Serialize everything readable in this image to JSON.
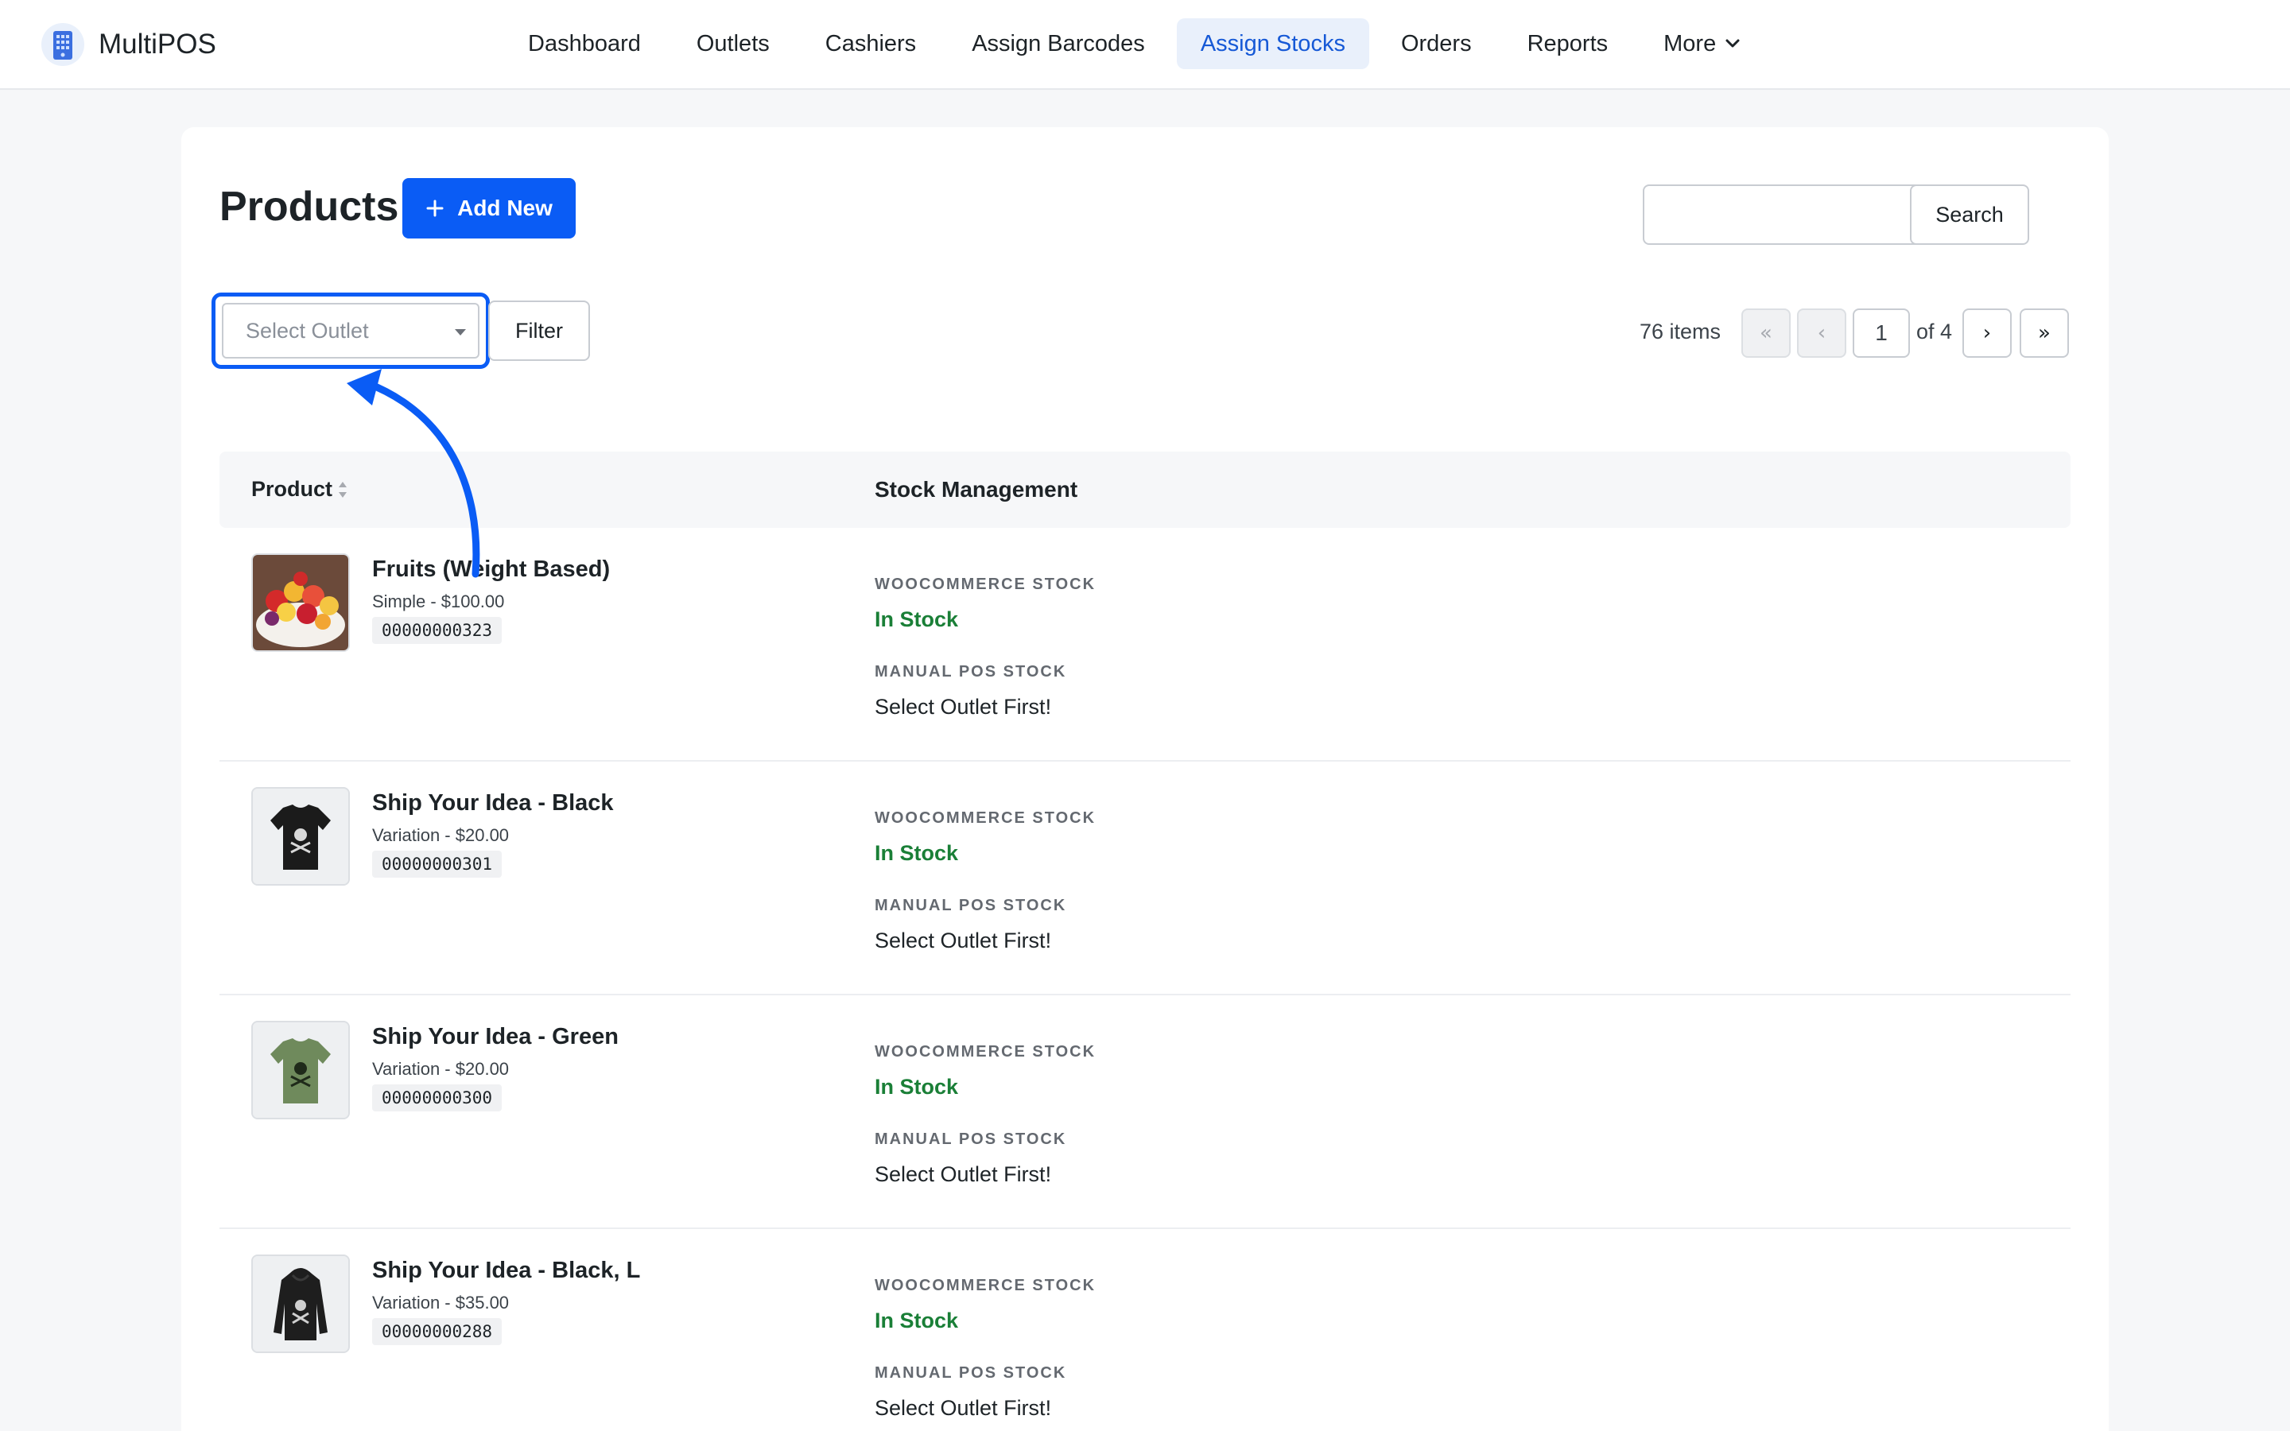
{
  "brand": {
    "name": "MultiPOS"
  },
  "nav": {
    "items": [
      {
        "label": "Dashboard"
      },
      {
        "label": "Outlets"
      },
      {
        "label": "Cashiers"
      },
      {
        "label": "Assign Barcodes"
      },
      {
        "label": "Assign Stocks",
        "active": true
      },
      {
        "label": "Orders"
      },
      {
        "label": "Reports"
      },
      {
        "label": "More"
      }
    ]
  },
  "page": {
    "title": "Products",
    "add_new_label": "Add New",
    "search": {
      "value": "",
      "button_label": "Search"
    },
    "outlet_select": {
      "placeholder": "Select Outlet"
    },
    "filter_label": "Filter"
  },
  "pagination": {
    "items_count": "76 items",
    "first": "«",
    "prev": "‹",
    "current_page": "1",
    "of_pages": "of 4",
    "next": "›",
    "last": "»"
  },
  "table": {
    "columns": {
      "product": "Product",
      "stock": "Stock Management"
    },
    "rows": [
      {
        "name": "Fruits (Weight Based)",
        "meta": "Simple - $100.00",
        "sku": "00000000323",
        "thumb": "fruit-bowl",
        "woo_label": "WOOCOMMERCE STOCK",
        "woo_value": "In Stock",
        "pos_label": "MANUAL POS STOCK",
        "pos_value": "Select Outlet First!"
      },
      {
        "name": "Ship Your Idea - Black",
        "meta": "Variation - $20.00",
        "sku": "00000000301",
        "thumb": "black-tshirt",
        "woo_label": "WOOCOMMERCE STOCK",
        "woo_value": "In Stock",
        "pos_label": "MANUAL POS STOCK",
        "pos_value": "Select Outlet First!"
      },
      {
        "name": "Ship Your Idea - Green",
        "meta": "Variation - $20.00",
        "sku": "00000000300",
        "thumb": "green-tshirt",
        "woo_label": "WOOCOMMERCE STOCK",
        "woo_value": "In Stock",
        "pos_label": "MANUAL POS STOCK",
        "pos_value": "Select Outlet First!"
      },
      {
        "name": "Ship Your Idea - Black, L",
        "meta": "Variation - $35.00",
        "sku": "00000000288",
        "thumb": "black-hoodie",
        "woo_label": "WOOCOMMERCE STOCK",
        "woo_value": "In Stock",
        "pos_label": "MANUAL POS STOCK",
        "pos_value": "Select Outlet First!"
      }
    ]
  },
  "colors": {
    "accent": "#0a5cf5",
    "nav_active_bg": "#e9f0fb",
    "nav_active_text": "#1659d6",
    "in_stock": "#1a7f37"
  }
}
